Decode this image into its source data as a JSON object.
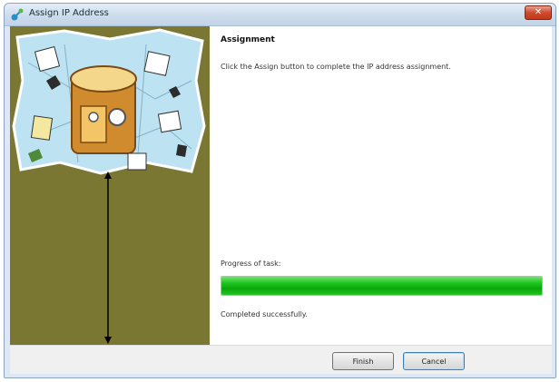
{
  "window": {
    "title": "Assign IP Address",
    "close_symbol": "✕"
  },
  "content": {
    "heading": "Assignment",
    "instruction": "Click the Assign button to complete the IP address assignment.",
    "progress_label": "Progress of task:",
    "progress_value_percent": 100,
    "status_text": "Completed successfully."
  },
  "footer": {
    "finish_label": "Finish",
    "cancel_label": "Cancel"
  },
  "icons": {
    "app": "network-icon",
    "close": "close-icon"
  },
  "colors": {
    "left_panel": "#7a7733",
    "progress_fill": "#1fc41f",
    "illustration_bg": "#bde3f3"
  }
}
